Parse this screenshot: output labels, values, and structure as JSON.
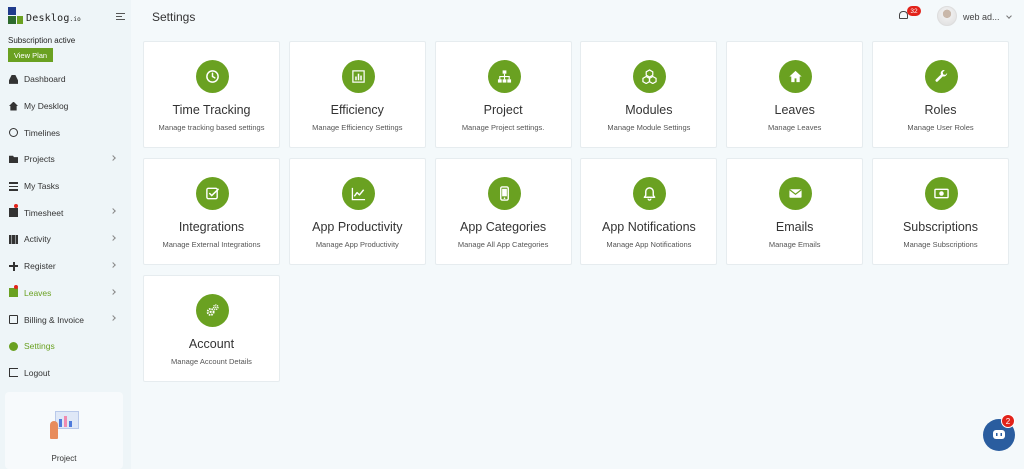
{
  "app": {
    "logo_text": "Desklog",
    "logo_suffix": ".io"
  },
  "sidebar": {
    "subscription_status": "Subscription active",
    "view_plan_label": "View Plan",
    "items": [
      {
        "label": "Dashboard",
        "icon": "dashboard-icon"
      },
      {
        "label": "My Desklog",
        "icon": "home-icon"
      },
      {
        "label": "Timelines",
        "icon": "clock-icon"
      },
      {
        "label": "Projects",
        "icon": "folder-icon"
      },
      {
        "label": "My Tasks",
        "icon": "tasks-icon"
      },
      {
        "label": "Timesheet",
        "icon": "timesheet-icon"
      },
      {
        "label": "Activity",
        "icon": "grid-icon"
      },
      {
        "label": "Register",
        "icon": "plus-icon"
      },
      {
        "label": "Leaves",
        "icon": "leaves-icon"
      },
      {
        "label": "Billing & Invoice",
        "icon": "invoice-icon"
      },
      {
        "label": "Settings",
        "icon": "gear-icon"
      },
      {
        "label": "Logout",
        "icon": "logout-icon"
      }
    ],
    "bottom_card_label": "Project"
  },
  "header": {
    "title": "Settings",
    "notification_count": "32",
    "user_name": "web ad..."
  },
  "cards": [
    {
      "title": "Time Tracking",
      "desc": "Manage tracking based settings",
      "icon": "clock-icon"
    },
    {
      "title": "Efficiency",
      "desc": "Manage Efficiency Settings",
      "icon": "bar-chart-icon"
    },
    {
      "title": "Project",
      "desc": "Manage Project settings.",
      "icon": "sitemap-icon"
    },
    {
      "title": "Modules",
      "desc": "Manage Module Settings",
      "icon": "cubes-icon"
    },
    {
      "title": "Leaves",
      "desc": "Manage Leaves",
      "icon": "home-icon"
    },
    {
      "title": "Roles",
      "desc": "Manage User Roles",
      "icon": "wrench-icon"
    },
    {
      "title": "Integrations",
      "desc": "Manage External Integrations",
      "icon": "check-square-icon"
    },
    {
      "title": "App Productivity",
      "desc": "Manage App Productivity",
      "icon": "line-chart-icon"
    },
    {
      "title": "App Categories",
      "desc": "Manage All App Categories",
      "icon": "mobile-icon"
    },
    {
      "title": "App Notifications",
      "desc": "Manage App Notifications",
      "icon": "bell-icon"
    },
    {
      "title": "Emails",
      "desc": "Manage Emails",
      "icon": "envelope-icon"
    },
    {
      "title": "Subscriptions",
      "desc": "Manage Subscriptions",
      "icon": "money-icon"
    },
    {
      "title": "Account",
      "desc": "Manage Account Details",
      "icon": "gears-icon"
    }
  ],
  "chat": {
    "badge_count": "2"
  },
  "colors": {
    "accent": "#6aa121",
    "sidebar_bg": "#eef5f8",
    "page_bg": "#f4f9fb",
    "badge": "#e2231a",
    "chat": "#2a5d9f"
  }
}
